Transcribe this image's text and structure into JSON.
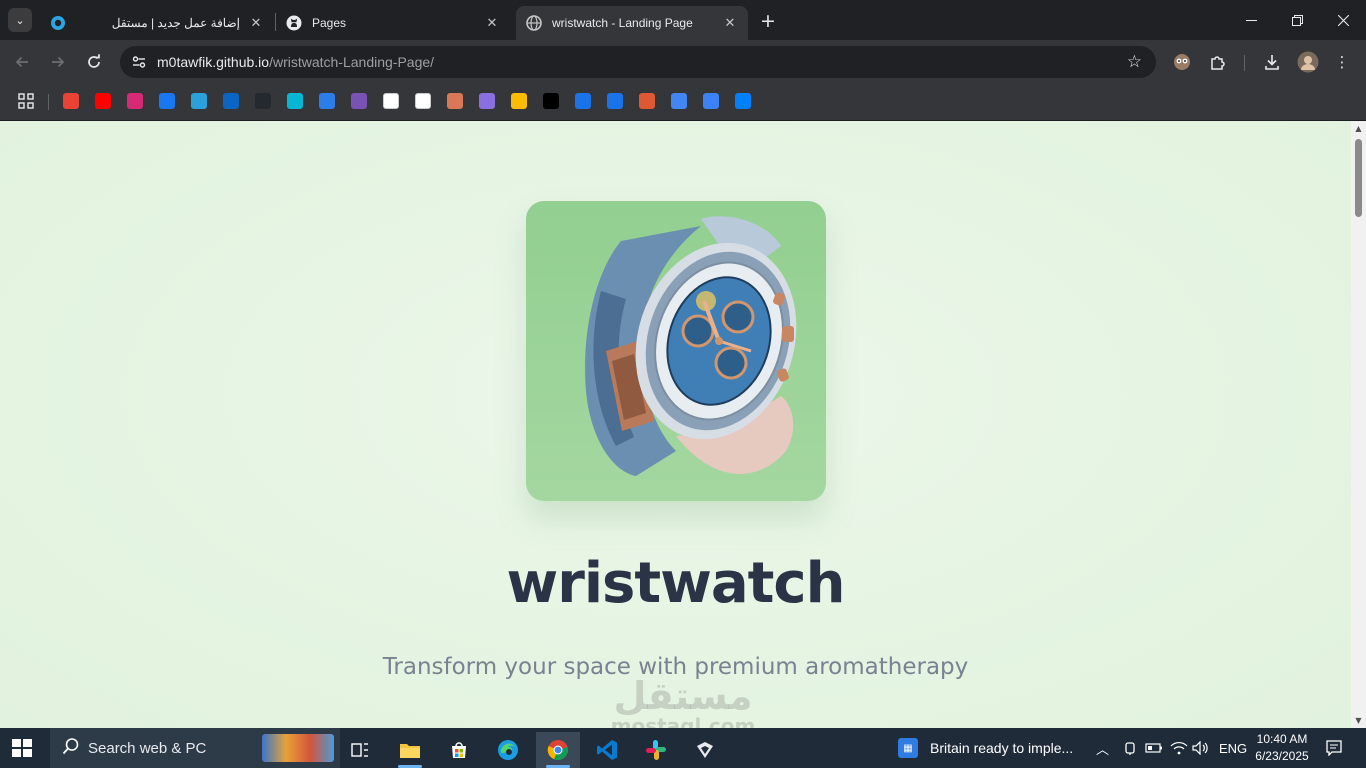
{
  "browser": {
    "tabs": [
      {
        "title": "إضافة عمل جديد | مستقل",
        "favicon": "mostaql-icon",
        "active": false
      },
      {
        "title": "Pages",
        "favicon": "github-icon",
        "active": false
      },
      {
        "title": "wristwatch - Landing Page",
        "favicon": "globe-icon",
        "active": true
      }
    ],
    "tab_search_icon": "chevron-down-icon",
    "new_tab_icon": "plus-icon",
    "window_controls": [
      "minimize-icon",
      "restore-icon",
      "close-icon"
    ],
    "url_host": "m0tawfik.github.io",
    "url_path": "/wristwatch-Landing-Page/",
    "bookmarks": [
      {
        "name": "apps-icon",
        "color": "#35363a"
      },
      {
        "name": "gmail-icon",
        "color": "#ea4335"
      },
      {
        "name": "youtube-icon",
        "color": "#ff0000"
      },
      {
        "name": "instagram-icon",
        "color": "#d62976"
      },
      {
        "name": "facebook-icon",
        "color": "#1877f2"
      },
      {
        "name": "telegram-icon",
        "color": "#2aa1da"
      },
      {
        "name": "linkedin-icon",
        "color": "#0a66c2"
      },
      {
        "name": "github-icon",
        "color": "#24292f"
      },
      {
        "name": "tailwind-icon",
        "color": "#06b6d4"
      },
      {
        "name": "tiptap-icon",
        "color": "#2b7de9"
      },
      {
        "name": "bootstrap-icon",
        "color": "#7952b3"
      },
      {
        "name": "notion-icon",
        "color": "#ffffff"
      },
      {
        "name": "chatgpt-icon",
        "color": "#ffffff"
      },
      {
        "name": "claude-icon",
        "color": "#d97757"
      },
      {
        "name": "copilot-icon",
        "color": "#8a6fe0"
      },
      {
        "name": "keep-icon",
        "color": "#fbbc04"
      },
      {
        "name": "terminal-icon",
        "color": "#000000"
      },
      {
        "name": "flag-icon",
        "color": "#1a73e8"
      },
      {
        "name": "forms-icon",
        "color": "#1a73e8"
      },
      {
        "name": "duck-icon",
        "color": "#de5833"
      },
      {
        "name": "translate-icon",
        "color": "#4285f4"
      },
      {
        "name": "bottle-icon",
        "color": "#3b82f6"
      },
      {
        "name": "meta-icon",
        "color": "#0081fb"
      }
    ]
  },
  "page": {
    "title": "wristwatch",
    "tagline": "Transform your space with premium aromatherapy",
    "watermark_ar": "مستقل",
    "watermark_en": "mostaql.com"
  },
  "taskbar": {
    "search_placeholder": "Search web & PC",
    "news": "Britain ready to imple...",
    "language": "ENG",
    "time": "10:40 AM",
    "date": "6/23/2025"
  }
}
